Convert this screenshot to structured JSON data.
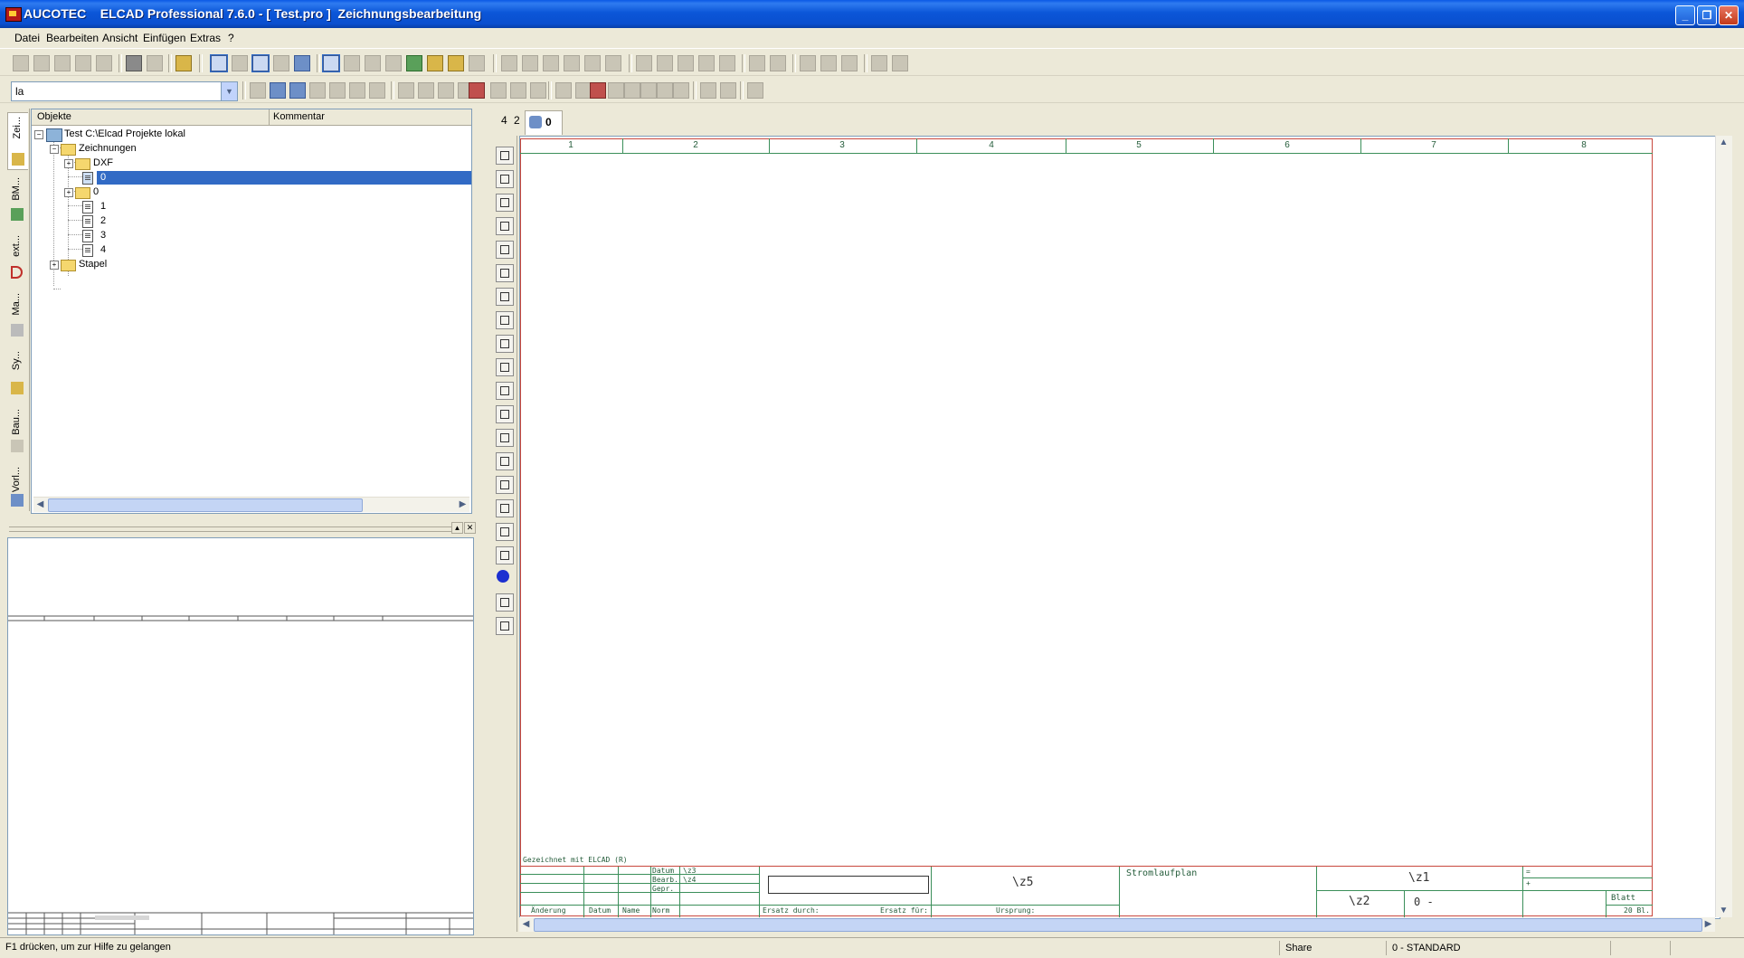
{
  "window": {
    "title": "AUCOTEC    ELCAD Professional 7.6.0 - [ Test.pro ]  Zeichnungsbearbeitung",
    "minimize": "_",
    "maximize": "❐",
    "close": "✕"
  },
  "menu": [
    {
      "label": "Datei"
    },
    {
      "label": "Bearbeiten"
    },
    {
      "label": "Ansicht"
    },
    {
      "label": "Einfügen"
    },
    {
      "label": "Extras"
    },
    {
      "label": "?"
    }
  ],
  "toolbar2": {
    "combo_value": "la"
  },
  "vtabs": [
    {
      "label": "Zei..."
    },
    {
      "label": "BM..."
    },
    {
      "label": "ext..."
    },
    {
      "label": "Ma..."
    },
    {
      "label": "Sy..."
    },
    {
      "label": "Bau..."
    },
    {
      "label": "Vorl..."
    }
  ],
  "tree": {
    "col_objects": "Objekte",
    "col_comment": "Kommentar",
    "root": "Test C:\\Elcad Projekte lokal",
    "zeichnungen": "Zeichnungen",
    "dxf": "DXF",
    "sel_item": "0",
    "folder_0": "0",
    "item_1": "1",
    "item_2": "2",
    "item_3": "3",
    "item_4": "4",
    "stapel": "Stapel"
  },
  "doc_tabs": {
    "tab_a": "4",
    "tab_b": "2",
    "tab_active": "0"
  },
  "sheet": {
    "columns": [
      "1",
      "2",
      "3",
      "4",
      "5",
      "6",
      "7",
      "8"
    ],
    "drawn_with": "Gezeichnet mit ELCAD (R)",
    "datum": "Datum",
    "bearb": "Bearb.",
    "gepr": "Gepr.",
    "norm": "Norm",
    "aenderung": "Änderung",
    "datum2": "Datum",
    "name": "Name",
    "z3": "\\z3",
    "z4": "\\z4",
    "ersatz_durch": "Ersatz durch:",
    "ersatz_fuer": "Ersatz für:",
    "ursprung": "Ursprung:",
    "z5": "\\z5",
    "stromlaufplan": "Stromlaufplan",
    "z1": "\\z1",
    "z2": "\\z2",
    "sheet_no": "0  -",
    "blatt": "Blatt",
    "bl_count": "20 Bl.",
    "eq": "=",
    "plus": "+"
  },
  "status": {
    "help": "F1 drücken, um zur Hilfe zu gelangen",
    "share": "Share",
    "standard": "0 - STANDARD"
  }
}
